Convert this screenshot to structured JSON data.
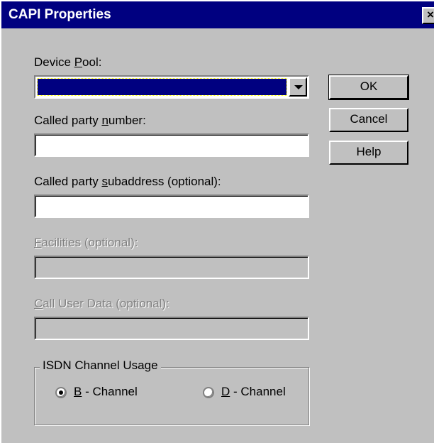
{
  "window": {
    "title": "CAPI Properties",
    "close_glyph": "×"
  },
  "device_pool": {
    "label_prefix": "Device ",
    "label_mnemonic": "P",
    "label_suffix": "ool:",
    "value": ""
  },
  "called_number": {
    "label_prefix": "Called party ",
    "label_mnemonic": "n",
    "label_suffix": "umber:",
    "value": ""
  },
  "called_subaddress": {
    "label_prefix": "Called party ",
    "label_mnemonic": "s",
    "label_suffix": "ubaddress (optional):",
    "value": ""
  },
  "facilities": {
    "label_mnemonic": "F",
    "label_suffix": "acilities (optional):",
    "value": "",
    "enabled": false
  },
  "call_user_data": {
    "label_mnemonic": "C",
    "label_suffix": "all User Data (optional):",
    "value": "",
    "enabled": false
  },
  "buttons": {
    "ok": "OK",
    "cancel": "Cancel",
    "help": "Help"
  },
  "channel_group": {
    "title": "ISDN Channel Usage",
    "b_mnemonic": "B",
    "b_suffix": " - Channel",
    "b_checked": true,
    "d_mnemonic": "D",
    "d_suffix": " - Channel",
    "d_checked": false
  },
  "colors": {
    "title_bar": "#000080",
    "face": "#c0c0c0",
    "selection": "#000080"
  }
}
